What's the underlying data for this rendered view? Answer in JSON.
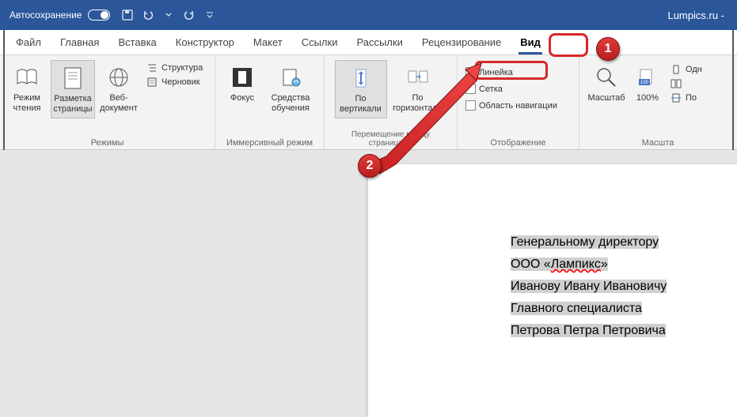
{
  "titlebar": {
    "autosave_label": "Автосохранение",
    "doc_title": "Lumpics.ru -"
  },
  "tabs": {
    "file": "Файл",
    "home": "Главная",
    "insert": "Вставка",
    "design": "Конструктор",
    "layout": "Макет",
    "references": "Ссылки",
    "mailings": "Рассылки",
    "review": "Рецензирование",
    "view": "Вид"
  },
  "ribbon": {
    "modes": {
      "group_label": "Режимы",
      "read": "Режим\nчтения",
      "print_layout": "Разметка\nстраницы",
      "web": "Веб-\nдокумент",
      "outline": "Структура",
      "draft": "Черновик"
    },
    "immersive": {
      "group_label": "Иммерсивный режим",
      "focus": "Фокус",
      "learning_tools": "Средства\nобучения"
    },
    "page_movement": {
      "group_label": "Перемещение между страницами",
      "vertical": "По\nвертикали",
      "horizontal": "По\nгоризонтали"
    },
    "show": {
      "group_label": "Отображение",
      "ruler": "Линейка",
      "gridlines": "Сетка",
      "navigation": "Область навигации"
    },
    "zoom": {
      "group_label": "Масшта",
      "zoom": "Масштаб",
      "hundred": "100%",
      "one_page": "Одн",
      "multi_page": "",
      "page_width": "По"
    }
  },
  "document": {
    "line1": "Генеральному директору",
    "line2_pre": "ООО «",
    "line2_squig": "Лампикс",
    "line2_post": "»",
    "line3": "Иванову Ивану Ивановичу",
    "line4": "Главного специалиста",
    "line5": "Петрова Петра Петровича"
  },
  "annotations": {
    "badge1": "1",
    "badge2": "2"
  }
}
